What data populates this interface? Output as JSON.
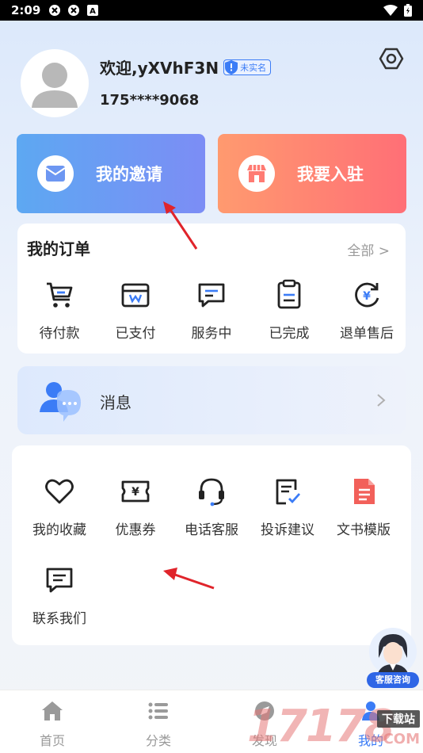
{
  "status_bar": {
    "time": "2:09"
  },
  "profile": {
    "username": "欢迎,yXVhF3N",
    "badge": "未实名",
    "phone": "175****9068"
  },
  "cards": {
    "invite": "我的邀请",
    "join": "我要入驻"
  },
  "orders": {
    "title": "我的订单",
    "all_link": "全部 >",
    "items": [
      {
        "label": "待付款",
        "icon": "cart-icon"
      },
      {
        "label": "已支付",
        "icon": "wallet-icon"
      },
      {
        "label": "服务中",
        "icon": "chat-icon"
      },
      {
        "label": "已完成",
        "icon": "clipboard-icon"
      },
      {
        "label": "退单售后",
        "icon": "refund-icon"
      }
    ]
  },
  "message": {
    "label": "消息"
  },
  "services": {
    "items": [
      {
        "label": "我的收藏",
        "icon": "heart-icon"
      },
      {
        "label": "优惠券",
        "icon": "coupon-icon"
      },
      {
        "label": "电话客服",
        "icon": "headset-icon"
      },
      {
        "label": "投诉建议",
        "icon": "complaint-icon"
      },
      {
        "label": "文书模版",
        "icon": "document-icon"
      },
      {
        "label": "联系我们",
        "icon": "message-icon"
      }
    ]
  },
  "float_service": {
    "label": "客服咨询"
  },
  "tabbar": {
    "items": [
      {
        "label": "首页",
        "icon": "home-icon"
      },
      {
        "label": "分类",
        "icon": "list-icon"
      },
      {
        "label": "发现",
        "icon": "discover-icon"
      },
      {
        "label": "我的",
        "icon": "user-icon",
        "active": true
      }
    ]
  },
  "watermark": {
    "number": "17178",
    "tag": "下载站",
    "suffix": "COM"
  },
  "colors": {
    "accent": "#3b7cf6",
    "invite_gradient": [
      "#5da8f2",
      "#7c8df5"
    ],
    "join_gradient": [
      "#ff9a6f",
      "#ff6f76"
    ],
    "arrow": "#e0242b"
  }
}
